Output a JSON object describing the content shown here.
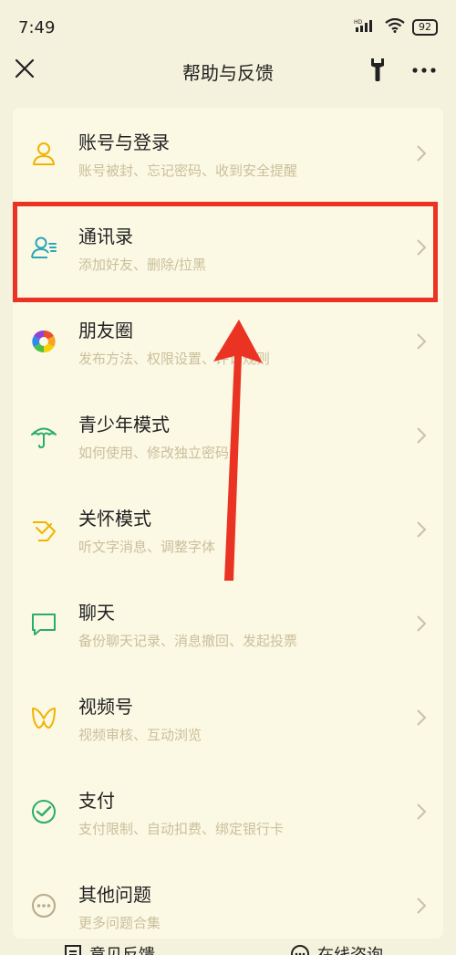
{
  "status": {
    "time": "7:49",
    "battery": "92",
    "signal_label": "HD"
  },
  "nav": {
    "title": "帮助与反馈"
  },
  "items": [
    {
      "title": "账号与登录",
      "subtitle": "账号被封、忘记密码、收到安全提醒",
      "icon": "user-icon"
    },
    {
      "title": "通讯录",
      "subtitle": "添加好友、删除/拉黑",
      "icon": "contacts-icon"
    },
    {
      "title": "朋友圈",
      "subtitle": "发布方法、权限设置、评论规则",
      "icon": "moments-icon"
    },
    {
      "title": "青少年模式",
      "subtitle": "如何使用、修改独立密码",
      "icon": "umbrella-icon"
    },
    {
      "title": "关怀模式",
      "subtitle": "听文字消息、调整字体",
      "icon": "care-icon"
    },
    {
      "title": "聊天",
      "subtitle": "备份聊天记录、消息撤回、发起投票",
      "icon": "chat-icon"
    },
    {
      "title": "视频号",
      "subtitle": "视频审核、互动浏览",
      "icon": "channels-icon"
    },
    {
      "title": "支付",
      "subtitle": "支付限制、自动扣费、绑定银行卡",
      "icon": "payment-icon"
    },
    {
      "title": "其他问题",
      "subtitle": "更多问题合集",
      "icon": "more-circle-icon"
    }
  ],
  "bottom": {
    "feedback": "意见反馈",
    "consult": "在线咨询"
  },
  "colors": {
    "highlight": "#ea3323",
    "accent_yellow": "#f0b400",
    "green": "#2aae67"
  }
}
